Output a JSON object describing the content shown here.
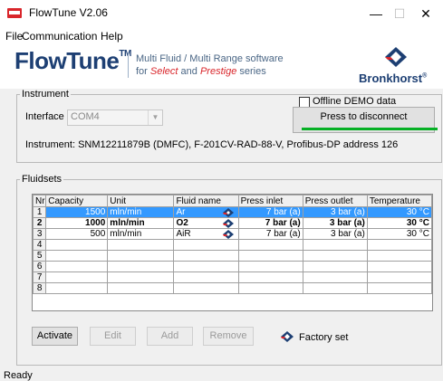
{
  "window": {
    "title": "FlowTune V2.06",
    "minimize": "—",
    "maximize": "☐",
    "close": "✕"
  },
  "menu": {
    "file": "File",
    "communication": "Communication",
    "help": "Help"
  },
  "header": {
    "logo": "FlowTune",
    "logo_tm": "TM",
    "tagline_1": "Multi Fluid / Multi Range software",
    "tagline_2_prefix": "for ",
    "tagline_2_select": "Select",
    "tagline_2_and": " and ",
    "tagline_2_prestige": "Prestige",
    "tagline_2_suffix": " series",
    "brand": "Bronkhorst",
    "brand_reg": "®"
  },
  "instrument": {
    "group_label": "Instrument",
    "interface_label": "Interface",
    "interface_value": "COM4",
    "offline_label": "Offline DEMO data",
    "offline_checked": false,
    "disconnect_button": "Press to disconnect",
    "info": "Instrument: SNM12211879B (DMFC), F-201CV-RAD-88-V, Profibus-DP address 126"
  },
  "fluidsets": {
    "group_label": "Fluidsets",
    "columns": [
      "Nr",
      "Capacity",
      "Unit",
      "Fluid name",
      "Press inlet",
      "Press outlet",
      "Temperature"
    ],
    "rows": [
      {
        "nr": "1",
        "capacity": "1500",
        "unit": "mln/min",
        "fluid": "Ar",
        "factory": true,
        "press_inlet": "7 bar (a)",
        "press_outlet": "3 bar (a)",
        "temperature": "30 °C",
        "selected": true,
        "bold": false
      },
      {
        "nr": "2",
        "capacity": "1000",
        "unit": "mln/min",
        "fluid": "O2",
        "factory": true,
        "press_inlet": "7 bar (a)",
        "press_outlet": "3 bar (a)",
        "temperature": "30 °C",
        "selected": false,
        "bold": true
      },
      {
        "nr": "3",
        "capacity": "500",
        "unit": "mln/min",
        "fluid": "AiR",
        "factory": true,
        "press_inlet": "7 bar (a)",
        "press_outlet": "3 bar (a)",
        "temperature": "30 °C",
        "selected": false,
        "bold": false
      },
      {
        "nr": "4",
        "capacity": "",
        "unit": "",
        "fluid": "",
        "factory": false,
        "press_inlet": "",
        "press_outlet": "",
        "temperature": "",
        "selected": false,
        "bold": false
      },
      {
        "nr": "5",
        "capacity": "",
        "unit": "",
        "fluid": "",
        "factory": false,
        "press_inlet": "",
        "press_outlet": "",
        "temperature": "",
        "selected": false,
        "bold": false
      },
      {
        "nr": "6",
        "capacity": "",
        "unit": "",
        "fluid": "",
        "factory": false,
        "press_inlet": "",
        "press_outlet": "",
        "temperature": "",
        "selected": false,
        "bold": false
      },
      {
        "nr": "7",
        "capacity": "",
        "unit": "",
        "fluid": "",
        "factory": false,
        "press_inlet": "",
        "press_outlet": "",
        "temperature": "",
        "selected": false,
        "bold": false
      },
      {
        "nr": "8",
        "capacity": "",
        "unit": "",
        "fluid": "",
        "factory": false,
        "press_inlet": "",
        "press_outlet": "",
        "temperature": "",
        "selected": false,
        "bold": false
      }
    ],
    "buttons": {
      "activate": "Activate",
      "edit": "Edit",
      "add": "Add",
      "remove": "Remove"
    },
    "legend": "Factory set"
  },
  "status": {
    "text": "Ready"
  },
  "colors": {
    "accent": "#1d3f73",
    "brand_red": "#d9262b",
    "selection": "#3399ff",
    "progress": "#06b025"
  }
}
